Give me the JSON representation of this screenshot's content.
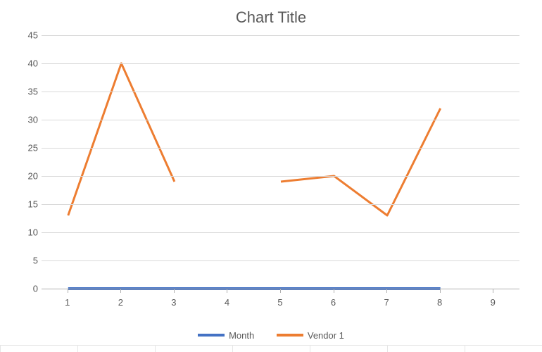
{
  "chart_data": {
    "type": "line",
    "title": "Chart Title",
    "categories": [
      1,
      2,
      3,
      4,
      5,
      6,
      7,
      8,
      9
    ],
    "series": [
      {
        "name": "Month",
        "color": "#4472C4",
        "values": [
          0,
          0,
          0,
          0,
          0,
          0,
          0,
          0
        ]
      },
      {
        "name": "Vendor 1",
        "color": "#ED7D31",
        "values": [
          13,
          40,
          19,
          null,
          19,
          20,
          13,
          32
        ]
      }
    ],
    "ylim": [
      0,
      45
    ],
    "ytick_step": 5,
    "xlabel": "",
    "ylabel": ""
  },
  "legend": {
    "s0": "Month",
    "s1": "Vendor 1"
  }
}
